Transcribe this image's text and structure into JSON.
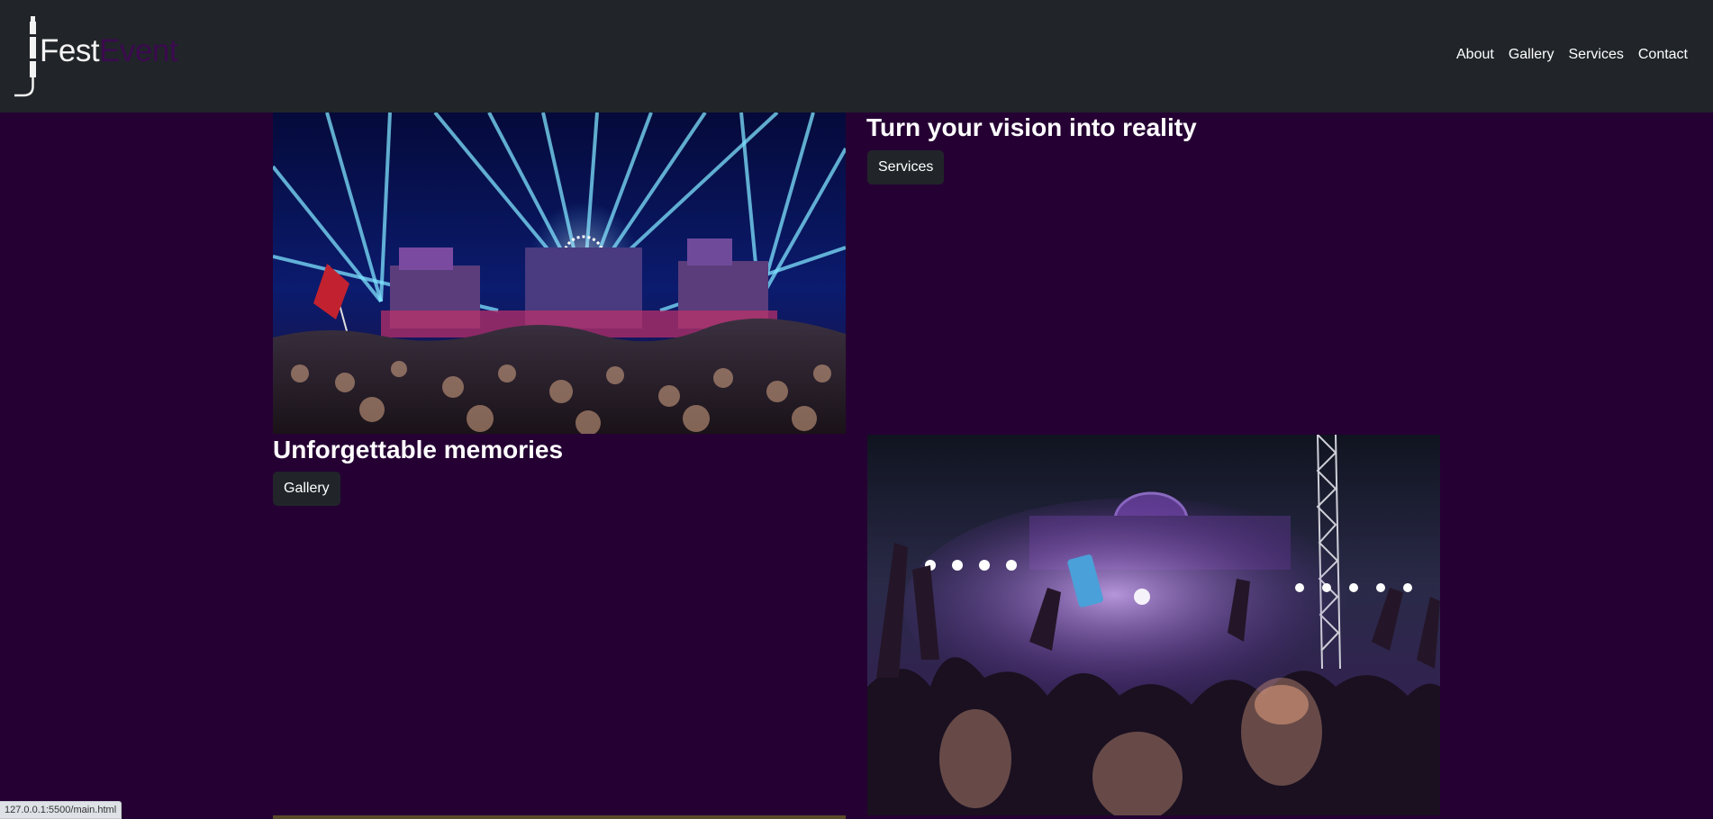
{
  "brand": {
    "part1": "Fest",
    "part2": "Event",
    "icon": "audio-jack-icon"
  },
  "nav": {
    "items": [
      {
        "label": "About"
      },
      {
        "label": "Gallery"
      },
      {
        "label": "Services"
      },
      {
        "label": "Contact"
      }
    ]
  },
  "section1": {
    "heading": "Turn your vision into reality",
    "button_label": "Services",
    "image": "festival-lasers-crowd-photo"
  },
  "section2": {
    "heading": "Unforgettable memories",
    "button_label": "Gallery",
    "image": "concert-purple-stage-crowd-photo"
  },
  "status_bar": {
    "url": "127.0.0.1:5500/main.html"
  },
  "colors": {
    "page_background": "#250033",
    "navbar_background": "#212529",
    "button_background": "#212529",
    "brand_accent": "#3b0a4f"
  }
}
